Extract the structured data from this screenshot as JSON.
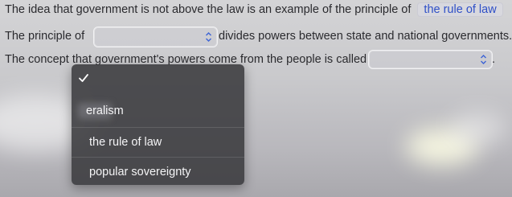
{
  "question_lines": {
    "line1": "The idea that government is not above the law is an example of the principle of",
    "line1_answer": "the rule of law",
    "line2_prefix": "The principle of",
    "line2_suffix": "divides powers between state and national governments.",
    "line3_prefix": "The concept that government's powers come from the people is called",
    "line3_suffix": "."
  },
  "dropdown_menu": {
    "options": [
      "eralism",
      "the rule of law",
      "popular sovereignty"
    ]
  },
  "icons": {
    "check": "checkmark-icon",
    "select_chevron": "updown-chevron-icon"
  },
  "colors": {
    "answer_text": "#2f50c7",
    "menu_background": "#3a3a3e",
    "menu_text": "#f4f4f6"
  }
}
